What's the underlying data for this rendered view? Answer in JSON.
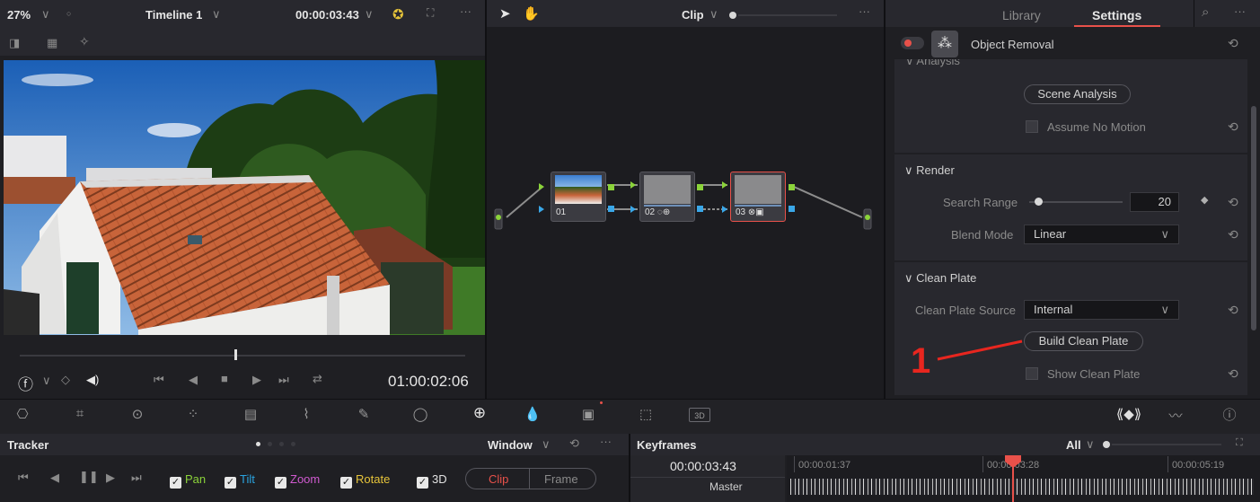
{
  "viewer": {
    "zoom": "27%",
    "timeline_name": "Timeline 1",
    "timecode_top": "00:00:03:43",
    "timecode_bottom": "01:00:02:06"
  },
  "nodes": {
    "mode_label": "Clip",
    "node1_label": "01",
    "node2_label": "02",
    "node3_label": "03"
  },
  "inspector": {
    "tab_library": "Library",
    "tab_settings": "Settings",
    "effect_title": "Object Removal",
    "section_analysis": "Analysis",
    "scene_analysis_button": "Scene Analysis",
    "assume_no_motion_label": "Assume No Motion",
    "section_render": "Render",
    "search_range_label": "Search Range",
    "search_range_value": "20",
    "search_range_fraction": 0.1,
    "blend_mode_label": "Blend Mode",
    "blend_mode_value": "Linear",
    "section_clean_plate": "Clean Plate",
    "clean_plate_source_label": "Clean Plate Source",
    "clean_plate_source_value": "Internal",
    "build_clean_plate_button": "Build Clean Plate",
    "show_clean_plate_label": "Show Clean Plate",
    "annotation_number": "1"
  },
  "tracker": {
    "title": "Tracker",
    "window_dropdown": "Window",
    "pan": "Pan",
    "tilt": "Tilt",
    "zoom": "Zoom",
    "rotate": "Rotate",
    "threed": "3D",
    "clip_tab": "Clip",
    "frame_tab": "Frame"
  },
  "keyframes": {
    "title": "Keyframes",
    "filter": "All",
    "current_time": "00:00:03:43",
    "track_name": "Master",
    "ruler_1": "00:00:01:37",
    "ruler_2": "00:00:03:28",
    "ruler_3": "00:00:05:19"
  },
  "toolbar": {
    "threed_badge": "3D"
  },
  "colors": {
    "accent_red": "#e8514a",
    "port_green": "#8bd33a",
    "port_blue": "#3aa7e8",
    "tab_underline": "#e8514a"
  }
}
